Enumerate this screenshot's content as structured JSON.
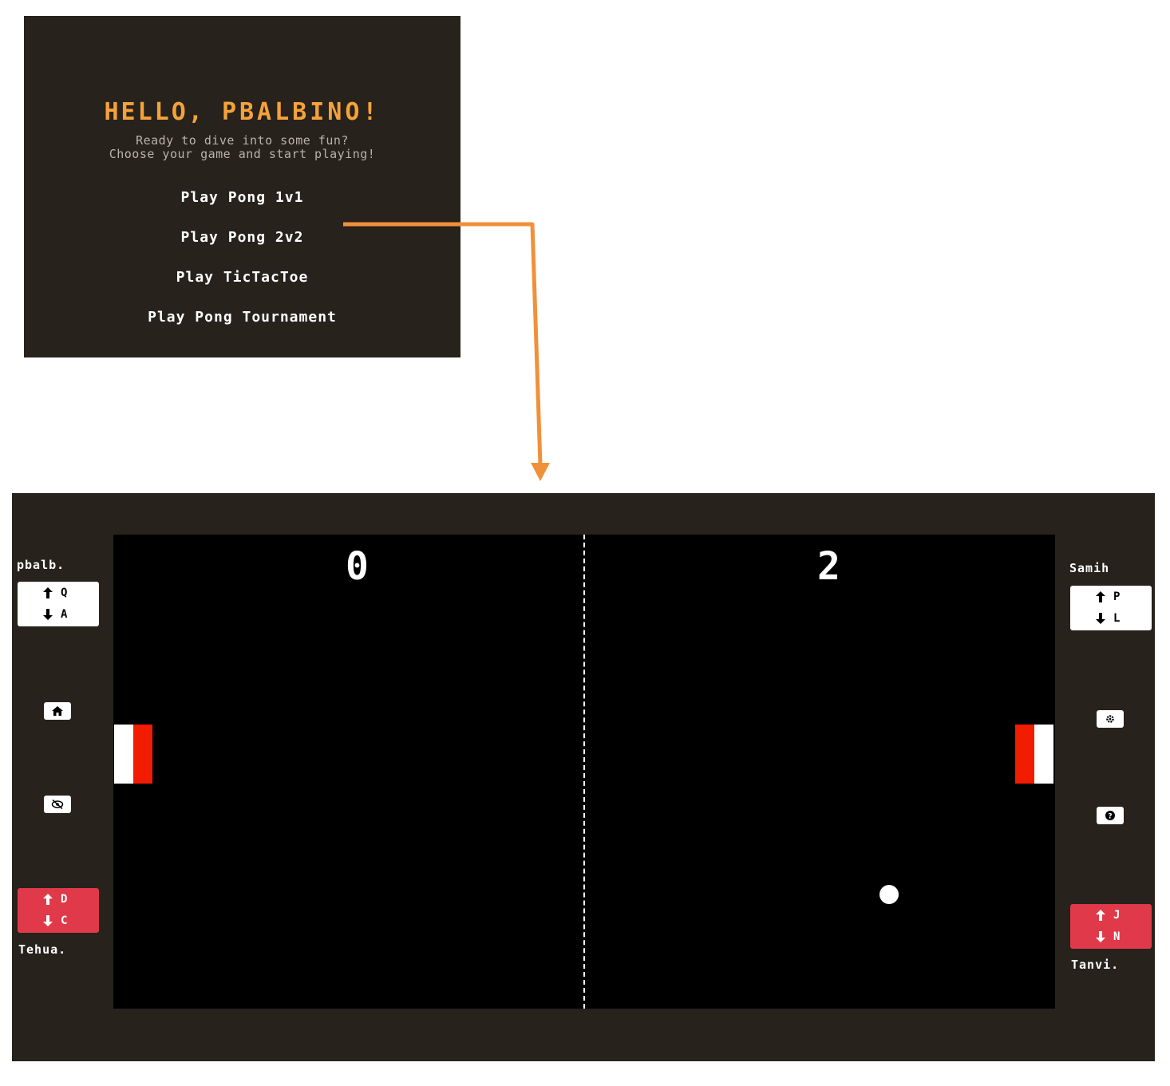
{
  "menu": {
    "greeting": "HELLO,",
    "username": "PBALBINO!",
    "subtitle_line1": "Ready to dive into some fun?",
    "subtitle_line2": "Choose your game and start playing!",
    "items": [
      {
        "label": "Play Pong 1v1"
      },
      {
        "label": "Play Pong 2v2"
      },
      {
        "label": "Play TicTacToe"
      },
      {
        "label": "Play Pong Tournament"
      }
    ],
    "colors": {
      "background": "#27221c",
      "title": "#f5a23a",
      "subtitle": "#b8b3ab"
    }
  },
  "connector": {
    "color": "#f0913a",
    "from": "Play Pong 2v2",
    "to": "game-view"
  },
  "game": {
    "scores": {
      "left": "0",
      "right": "2"
    },
    "players": {
      "top_left": {
        "name": "pbalb.",
        "up_key": "Q",
        "down_key": "A",
        "color": "#ffffff"
      },
      "bottom_left": {
        "name": "Tehua.",
        "up_key": "D",
        "down_key": "C",
        "color": "#e03a4a"
      },
      "top_right": {
        "name": "Samih",
        "up_key": "P",
        "down_key": "L",
        "color": "#ffffff"
      },
      "bottom_right": {
        "name": "Tanvi.",
        "up_key": "J",
        "down_key": "N",
        "color": "#e03a4a"
      }
    },
    "icons": {
      "left_top": "home-icon",
      "left_bottom": "eye-slash-icon",
      "right_top": "gear-icon",
      "right_bottom": "question-icon"
    },
    "colors": {
      "court": "#000000",
      "paddle_white": "#ffffff",
      "paddle_red": "#f21c00",
      "ball": "#ffffff"
    }
  }
}
